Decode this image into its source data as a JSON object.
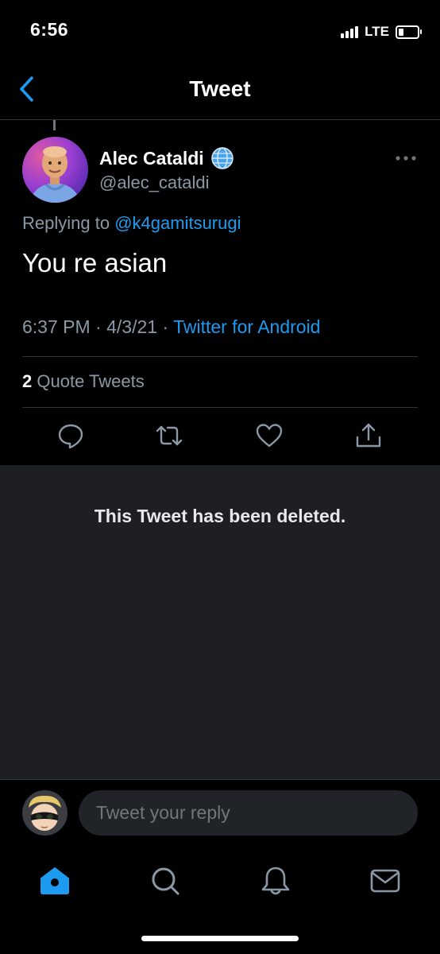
{
  "status_bar": {
    "time": "6:56",
    "network": "LTE",
    "signal_bars": 4,
    "battery_level": 0.25
  },
  "header": {
    "title": "Tweet",
    "back_icon": "chevron-left-icon"
  },
  "tweet": {
    "author_name": "Alec Cataldi",
    "author_handle": "@alec_cataldi",
    "replying_prefix": "Replying to",
    "replying_to": "@k4gamitsurugi",
    "text": "You re asian",
    "time": "6:37 PM",
    "separator": "·",
    "date": "4/3/21",
    "source": "Twitter for Android",
    "quote_count": "2",
    "quote_label": "Quote Tweets"
  },
  "deleted_notice": "This Tweet has been deleted.",
  "reply": {
    "placeholder": "Tweet your reply"
  },
  "colors": {
    "accent": "#1d9bf0",
    "background": "#000000",
    "panel": "#1d1f23",
    "muted": "#8b98a5"
  },
  "tab_bar": [
    "home-icon",
    "search-icon",
    "notifications-icon",
    "messages-icon"
  ]
}
